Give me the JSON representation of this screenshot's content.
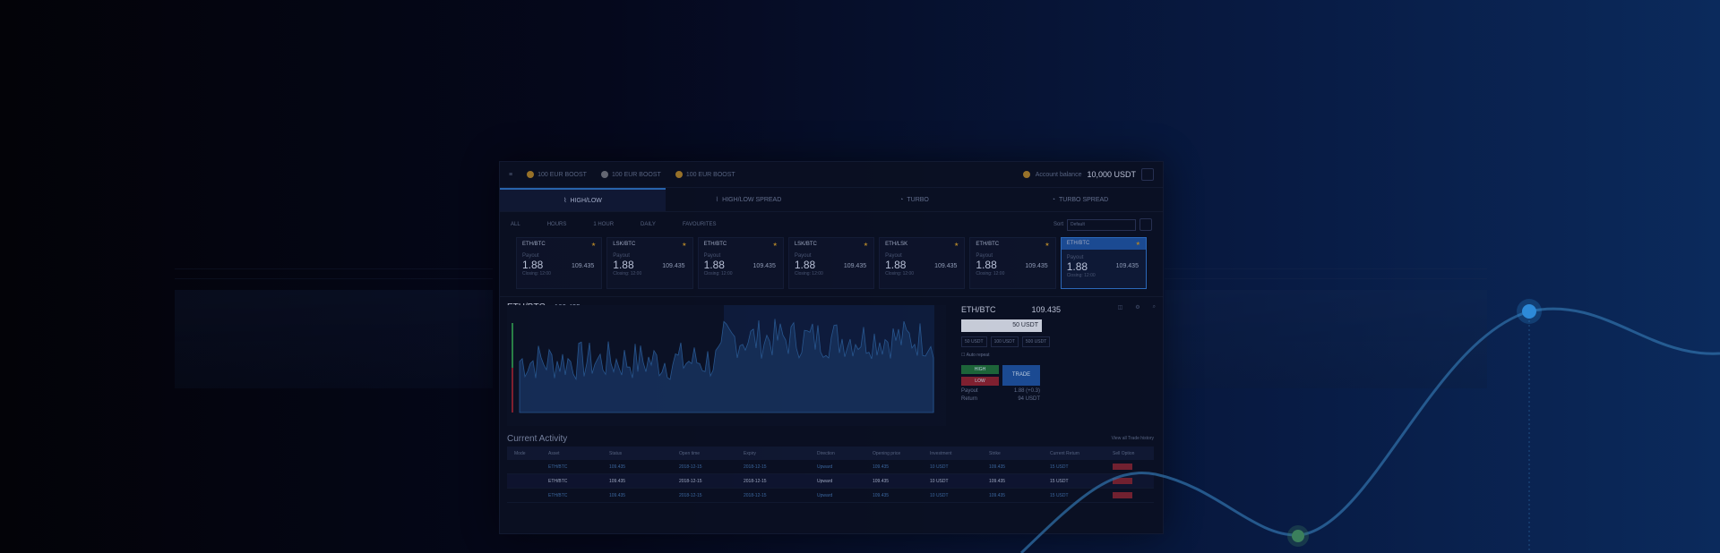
{
  "topbar": {
    "coins": [
      {
        "label": "100 EUR BOOST",
        "color": "gold"
      },
      {
        "label": "100 EUR BOOST",
        "color": "gray"
      },
      {
        "label": "100 EUR BOOST",
        "color": "gold"
      }
    ],
    "balance_label": "Account balance",
    "balance": "10,000 USDT"
  },
  "modes": [
    "HIGH/LOW",
    "HIGH/LOW SPREAD",
    "TURBO",
    "TURBO SPREAD"
  ],
  "filters": [
    "ALL",
    "HOURS",
    "1 HOUR",
    "DAILY",
    "FAVOURITES"
  ],
  "sort": {
    "label": "Sort",
    "value": "Default"
  },
  "cards": [
    {
      "pair": "ETH/BTC",
      "payout_label": "Payout",
      "payout": "1.88",
      "price": "109.435",
      "expiry": "Closing: 12:00"
    },
    {
      "pair": "LSK/BTC",
      "payout_label": "Payout",
      "payout": "1.88",
      "price": "109.435",
      "expiry": "Closing: 12:00"
    },
    {
      "pair": "ETH/BTC",
      "payout_label": "Payout",
      "payout": "1.88",
      "price": "109.435",
      "expiry": "Closing: 12:00"
    },
    {
      "pair": "LSK/BTC",
      "payout_label": "Payout",
      "payout": "1.88",
      "price": "109.435",
      "expiry": "Closing: 12:00"
    },
    {
      "pair": "ETH/LSK",
      "payout_label": "Payout",
      "payout": "1.88",
      "price": "109.435",
      "expiry": "Closing: 12:00"
    },
    {
      "pair": "ETH/BTC",
      "payout_label": "Payout",
      "payout": "1.88",
      "price": "109.435",
      "expiry": "Closing: 12:00"
    },
    {
      "pair": "ETH/BTC",
      "payout_label": "Payout",
      "payout": "1.88",
      "price": "109.435",
      "expiry": "Closing: 12:00"
    }
  ],
  "chart": {
    "pair": "ETH/BTC",
    "price": "109.435"
  },
  "trade": {
    "pair": "ETH/BTC",
    "price": "109.435",
    "amount": "50 USDT",
    "quick": [
      "50 USDT",
      "100 USDT",
      "500 USDT"
    ],
    "checkbox": "Auto repeat",
    "high": "HIGH",
    "low": "LOW",
    "trade": "TRADE",
    "payout_label": "Payout",
    "payout": "1.88 (+0.3)",
    "return_label": "Return",
    "return": "94 USDT"
  },
  "activity": {
    "title": "Current Activity",
    "link": "View all Trade history",
    "columns": [
      "Mode",
      "Asset",
      "Status",
      "Open time",
      "Expiry",
      "Direction",
      "Opening price",
      "Investment",
      "Strike",
      "Current Return",
      "Sell Option"
    ],
    "rows": [
      {
        "mode": "",
        "asset": "ETH/BTC",
        "status": "109.435",
        "open": "2018-12-15",
        "expiry": "2018-12-15",
        "dir": "Upward",
        "price": "109.435",
        "inv": "10 USDT",
        "strike": "109.435",
        "ret": "15 USDT",
        "sell": "",
        "active": false
      },
      {
        "mode": "",
        "asset": "ETH/BTC",
        "status": "109.435",
        "open": "2018-12-15",
        "expiry": "2018-12-15",
        "dir": "Upward",
        "price": "109.435",
        "inv": "10 USDT",
        "strike": "109.435",
        "ret": "15 USDT",
        "sell": "",
        "active": true
      },
      {
        "mode": "",
        "asset": "ETH/BTC",
        "status": "109.435",
        "open": "2018-12-15",
        "expiry": "2018-12-15",
        "dir": "Upward",
        "price": "109.435",
        "inv": "10 USDT",
        "strike": "109.435",
        "ret": "15 USDT",
        "sell": "",
        "active": false
      }
    ]
  },
  "colors": {
    "accent": "#2b6bb8",
    "curve": "#2f6da6",
    "marker_blue": "#2d8ad8",
    "marker_green": "#3b7f5c"
  }
}
